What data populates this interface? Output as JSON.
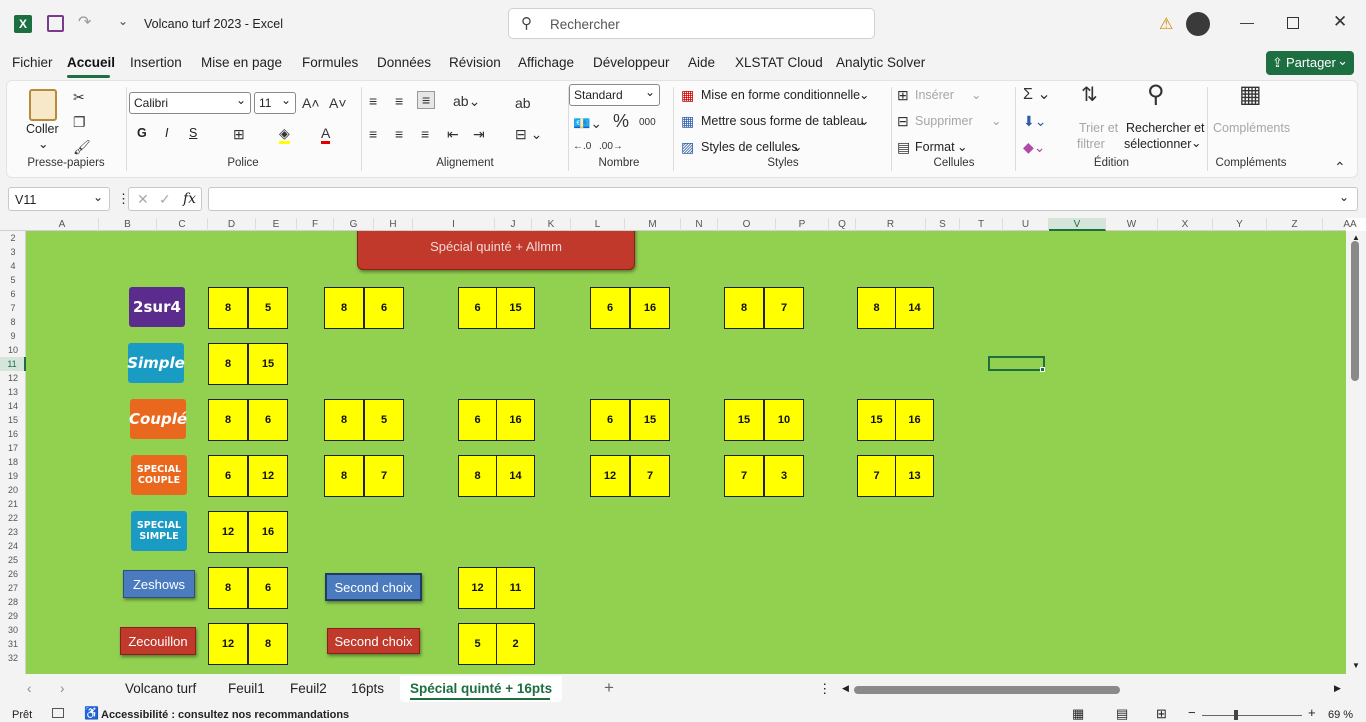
{
  "app": {
    "title": "Volcano turf 2023  -  Excel",
    "search_placeholder": "Rechercher",
    "accent": "#217346"
  },
  "menu": [
    "Fichier",
    "Accueil",
    "Insertion",
    "Mise en page",
    "Formules",
    "Données",
    "Révision",
    "Affichage",
    "Développeur",
    "Aide",
    "XLSTAT Cloud",
    "Analytic Solver"
  ],
  "share_label": "Partager",
  "ribbon": {
    "clipboard": {
      "paste": "Coller",
      "label": "Presse-papiers"
    },
    "font": {
      "name": "Calibri",
      "size": "11",
      "bold": "G",
      "italic": "I",
      "underline": "S",
      "label": "Police"
    },
    "alignment": {
      "label": "Alignement"
    },
    "number": {
      "format": "Standard",
      "label": "Nombre"
    },
    "styles": {
      "conditional": "Mise en forme conditionnelle",
      "table": "Mettre sous forme de tableau",
      "cell_styles": "Styles de cellules",
      "label": "Styles"
    },
    "cells": {
      "insert": "Insérer",
      "delete": "Supprimer",
      "format": "Format",
      "label": "Cellules"
    },
    "editing": {
      "sort": "Trier et",
      "sort2": "filtrer",
      "find": "Rechercher et",
      "find2": "sélectionner",
      "label": "Édition"
    },
    "addins": {
      "btn": "Compléments",
      "label": "Compléments"
    }
  },
  "formula": {
    "namebox": "V11",
    "fx": "fx",
    "value": ""
  },
  "columns": [
    "A",
    "B",
    "C",
    "D",
    "E",
    "F",
    "G",
    "H",
    "I",
    "J",
    "K",
    "L",
    "M",
    "N",
    "O",
    "P",
    "Q",
    "R",
    "S",
    "T",
    "U",
    "V",
    "W",
    "X",
    "Y",
    "Z",
    "AA",
    "AB"
  ],
  "rows": [
    "2",
    "3",
    "4",
    "5",
    "6",
    "7",
    "8",
    "9",
    "10",
    "11",
    "12",
    "13",
    "14",
    "15",
    "16",
    "17",
    "18",
    "19",
    "20",
    "21",
    "22",
    "23",
    "24",
    "25",
    "26",
    "27",
    "28",
    "29",
    "30",
    "31",
    "32"
  ],
  "sheet": {
    "header_button": "Spécial quinté + Allmm",
    "logos": [
      "2sur4",
      "Simple",
      "Couplé",
      "SPECIAL COUPLE",
      "SPECIAL SIMPLE"
    ],
    "shapes": {
      "zeshows": "Zeshows",
      "zecouillon": "Zecouillon",
      "second1": "Second choix",
      "second2": "Second choix"
    },
    "boxes": [
      [
        "8",
        "5",
        "8",
        "6",
        "6",
        "15",
        "6",
        "16",
        "8",
        "7",
        "8",
        "14"
      ],
      [
        "8",
        "15"
      ],
      [
        "8",
        "6",
        "8",
        "5",
        "6",
        "16",
        "6",
        "15",
        "15",
        "10",
        "15",
        "16"
      ],
      [
        "6",
        "12",
        "8",
        "7",
        "8",
        "14",
        "12",
        "7",
        "7",
        "3",
        "7",
        "13"
      ],
      [
        "12",
        "16"
      ],
      [
        "8",
        "6",
        "12",
        "11"
      ],
      [
        "12",
        "8",
        "5",
        "2"
      ]
    ]
  },
  "tabs": [
    "Volcano turf",
    "Feuil1",
    "Feuil2",
    "16pts",
    "Spécial quinté + 16pts"
  ],
  "active_tab": "Spécial quinté + 16pts",
  "status": {
    "ready": "Prêt",
    "accessibility": "Accessibilité : consultez nos recommandations",
    "zoom": "69 %"
  }
}
